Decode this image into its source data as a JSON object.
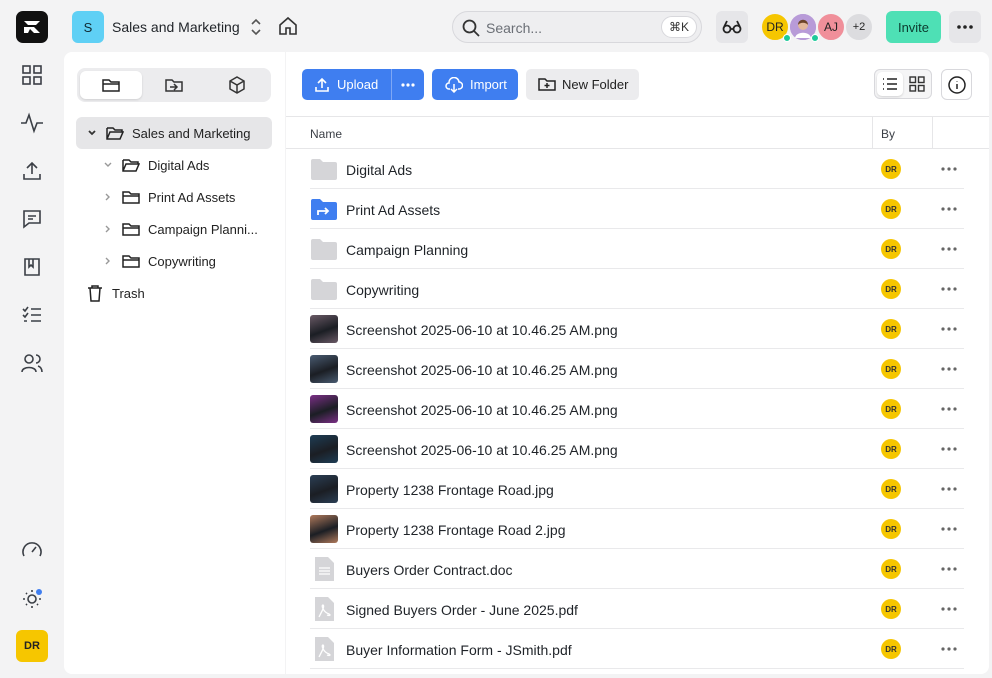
{
  "rail": {
    "nav_items": [
      "grid-icon",
      "activity-icon",
      "upload-icon",
      "message-icon",
      "book-icon",
      "checklist-icon",
      "users-icon"
    ],
    "bottom_items": [
      "gauge-icon",
      "sun-icon"
    ],
    "user_initials": "DR"
  },
  "header": {
    "workspace_initial": "S",
    "workspace_name": "Sales and Marketing",
    "search_placeholder": "Search...",
    "search_shortcut": "⌘K",
    "avatars": [
      {
        "initials": "DR",
        "color": "#f6c600",
        "online": true
      },
      {
        "initials": "",
        "color": "#b89bd8",
        "online": true
      },
      {
        "initials": "AJ",
        "color": "#f08f9a",
        "online": false
      }
    ],
    "extra_count": "+2",
    "invite_label": "Invite"
  },
  "sidebar": {
    "tree": [
      {
        "label": "Sales and Marketing",
        "level": 0,
        "expanded": true,
        "selected": true
      },
      {
        "label": "Digital Ads",
        "level": 1,
        "expanded": true
      },
      {
        "label": "Print Ad Assets",
        "level": 1
      },
      {
        "label": "Campaign Planni...",
        "level": 1
      },
      {
        "label": "Copywriting",
        "level": 1
      }
    ],
    "trash_label": "Trash"
  },
  "toolbar": {
    "upload_label": "Upload",
    "import_label": "Import",
    "new_folder_label": "New Folder"
  },
  "table": {
    "col_name": "Name",
    "col_by": "By",
    "rows": [
      {
        "name": "Digital Ads",
        "kind": "folder",
        "by": "DR"
      },
      {
        "name": "Print Ad Assets",
        "kind": "shared-folder",
        "by": "DR"
      },
      {
        "name": "Campaign Planning",
        "kind": "folder",
        "by": "DR"
      },
      {
        "name": "Copywriting",
        "kind": "folder",
        "by": "DR"
      },
      {
        "name": "Screenshot 2025-06-10 at 10.46.25 AM.png",
        "kind": "image",
        "thumb": "#6a5a66",
        "by": "DR"
      },
      {
        "name": "Screenshot 2025-06-10 at 10.46.25 AM.png",
        "kind": "image",
        "thumb": "#4a5c72",
        "by": "DR"
      },
      {
        "name": "Screenshot 2025-06-10 at 10.46.25 AM.png",
        "kind": "image",
        "thumb": "#7b2f86",
        "by": "DR"
      },
      {
        "name": "Screenshot 2025-06-10 at 10.46.25 AM.png",
        "kind": "image",
        "thumb": "#1e3d55",
        "by": "DR"
      },
      {
        "name": "Property 1238 Frontage Road.jpg",
        "kind": "image",
        "thumb": "#2b3f55",
        "by": "DR"
      },
      {
        "name": "Property 1238 Frontage Road 2.jpg",
        "kind": "image",
        "thumb": "#b07a5c",
        "by": "DR"
      },
      {
        "name": "Buyers Order Contract.doc",
        "kind": "doc",
        "by": "DR"
      },
      {
        "name": "Signed Buyers Order - June 2025.pdf",
        "kind": "pdf",
        "by": "DR"
      },
      {
        "name": "Buyer Information Form - JSmith.pdf",
        "kind": "pdf",
        "by": "DR"
      }
    ]
  }
}
